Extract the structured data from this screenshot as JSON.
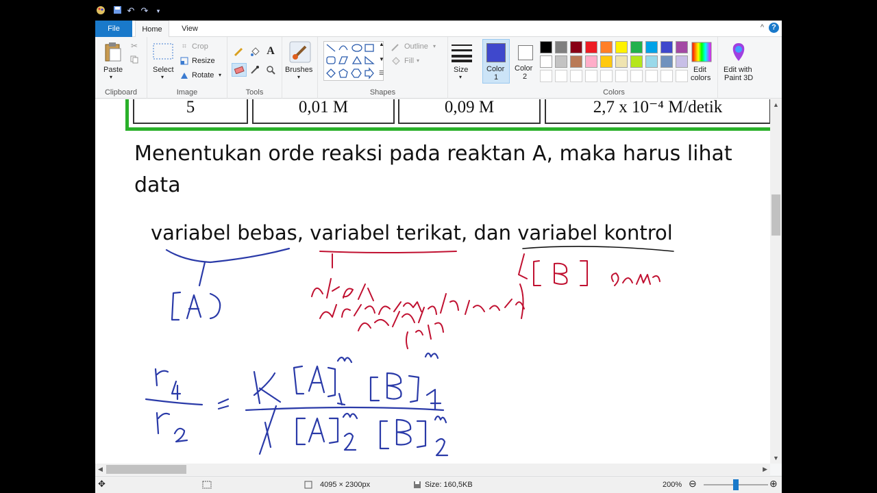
{
  "quick_access": {
    "undo": "↶",
    "redo": "↷"
  },
  "tabs": {
    "file": "File",
    "home": "Home",
    "view": "View"
  },
  "ribbon": {
    "clipboard": {
      "paste": "Paste",
      "group": "Clipboard"
    },
    "image": {
      "select": "Select",
      "crop": "Crop",
      "resize": "Resize",
      "rotate": "Rotate",
      "group": "Image"
    },
    "tools": {
      "group": "Tools",
      "text_tool": "A"
    },
    "brushes": {
      "label": "Brushes"
    },
    "shapes": {
      "outline": "Outline",
      "fill": "Fill",
      "group": "Shapes"
    },
    "size": {
      "label": "Size"
    },
    "color1": {
      "label_a": "Color",
      "label_b": "1",
      "value": "#3f48cc"
    },
    "color2": {
      "label_a": "Color",
      "label_b": "2",
      "value": "#ffffff"
    },
    "colors": {
      "group": "Colors",
      "row1": [
        "#000000",
        "#7f7f7f",
        "#880015",
        "#ed1c24",
        "#ff7f27",
        "#fff200",
        "#22b14c",
        "#00a2e8",
        "#3f48cc",
        "#a349a4"
      ],
      "row2": [
        "#ffffff",
        "#c3c3c3",
        "#b97a57",
        "#ffaec9",
        "#ffc90e",
        "#efe4b0",
        "#b5e61d",
        "#99d9ea",
        "#7092be",
        "#c8bfe7"
      ]
    },
    "edit_colors": {
      "line1": "Edit",
      "line2": "colors"
    },
    "paint3d": {
      "line1": "Edit with",
      "line2": "Paint 3D"
    }
  },
  "canvas": {
    "table_row": [
      "5",
      "0,01 M",
      "0,09 M",
      "2,7 x 10⁻⁴ M/detik"
    ],
    "heading": "Menentukan orde reaksi pada reaktan A, maka harus lihat data",
    "variables_line": "variabel bebas, variabel terikat, dan variabel kontrol"
  },
  "status": {
    "dimensions": "4095 × 2300px",
    "size": "Size: 160,5KB",
    "zoom": "200%"
  }
}
